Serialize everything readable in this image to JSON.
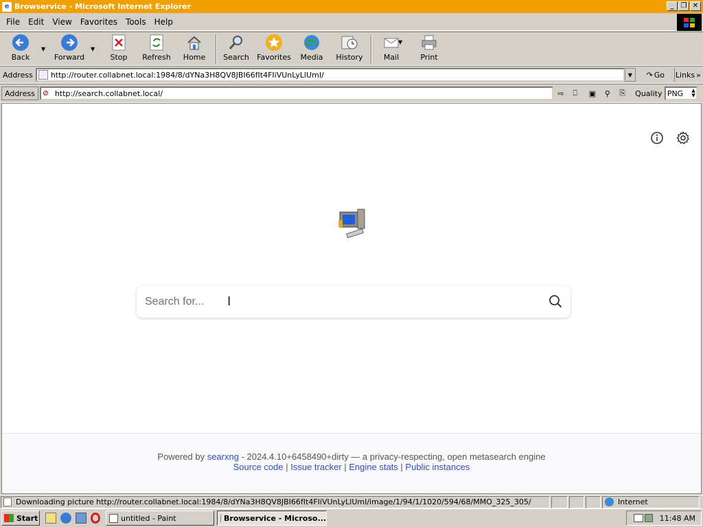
{
  "window": {
    "title": "Browservice - Microsoft Internet Explorer"
  },
  "menu": [
    "File",
    "Edit",
    "View",
    "Favorites",
    "Tools",
    "Help"
  ],
  "toolbar": {
    "back": "Back",
    "forward": "Forward",
    "stop": "Stop",
    "refresh": "Refresh",
    "home": "Home",
    "search": "Search",
    "favorites": "Favorites",
    "media": "Media",
    "history": "History",
    "mail": "Mail",
    "print": "Print"
  },
  "ie_address": {
    "label": "Address",
    "url": "http://router.collabnet.local:1984/8/dYNa3H8QV8JBI66fIt4FIiVUnLyLlUmI/",
    "go": "Go",
    "links": "Links"
  },
  "bs_address": {
    "label": "Address",
    "url": "http://search.collabnet.local/",
    "quality_label": "Quality",
    "quality_value": "PNG"
  },
  "page": {
    "search_placeholder": "Search for...",
    "footer_powered": "Powered by",
    "footer_engine_link": "searxng",
    "footer_rest": " - 2024.4.10+6458490+dirty — a privacy-respecting, open metasearch engine",
    "links": [
      "Source code",
      "Issue tracker",
      "Engine stats",
      "Public instances"
    ],
    "link_sep": " | "
  },
  "status": {
    "text": "Downloading picture http://router.collabnet.local:1984/8/dYNa3H8QV8JBI66fIt4FIiVUnLyLlUmI/image/1/94/1/1020/594/68/MMO_325_305/",
    "zone": "Internet"
  },
  "taskbar": {
    "start": "Start",
    "tasks": [
      "untitled - Paint",
      "Browservice - Microso..."
    ],
    "clock": "11:48 AM"
  },
  "colors": {
    "titlebar": "#f0a000",
    "chrome": "#d4d0c8",
    "link": "#3050b8"
  }
}
